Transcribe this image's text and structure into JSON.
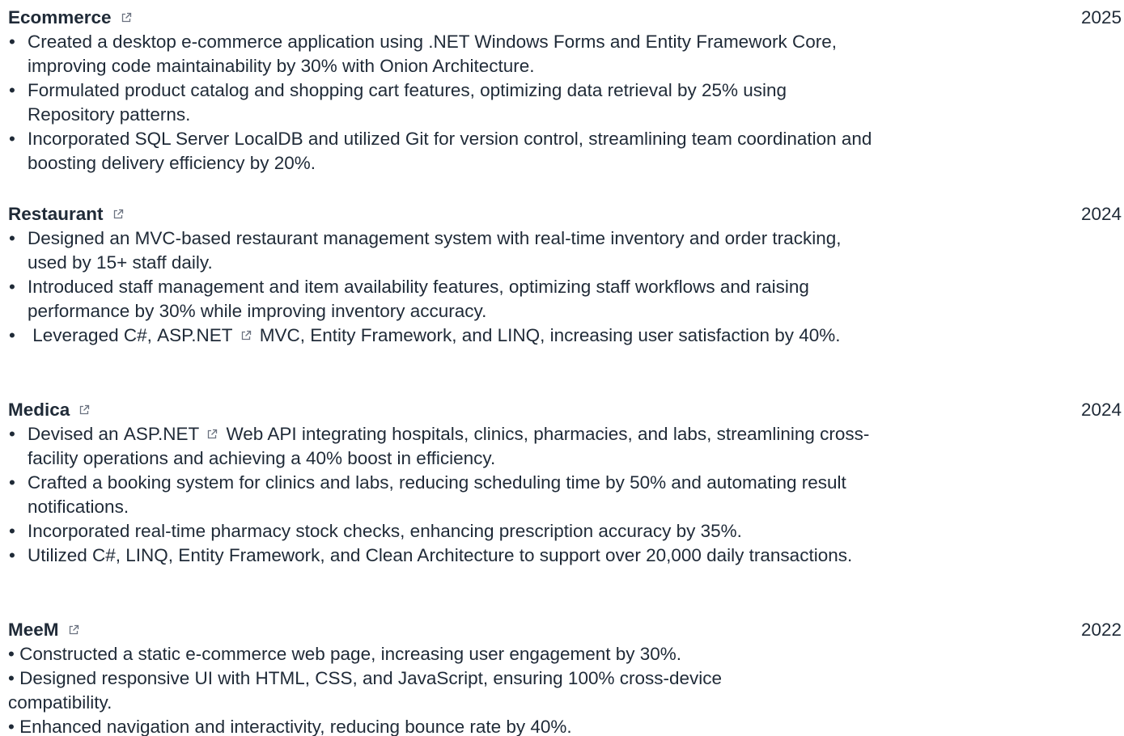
{
  "projects": [
    {
      "title": "Ecommerce",
      "year": "2025",
      "bullets": [
        "Created a desktop e-commerce application using .NET Windows Forms and Entity Framework Core, improving code maintainability by 30% with Onion Architecture.",
        "Formulated product catalog and shopping cart features, optimizing data retrieval by 25% using Repository patterns.",
        "Incorporated SQL Server LocalDB and utilized Git for version control, streamlining team coordination and boosting delivery efficiency by 20%."
      ]
    },
    {
      "title": "Restaurant",
      "year": "2024",
      "bullets": [
        "Designed an MVC-based restaurant management system with real-time inventory and order tracking, used by 15+ staff daily.",
        " Introduced staff management and item availability features, optimizing staff workflows and raising performance by 30% while improving inventory accuracy.",
        {
          "before": " Leveraged C#, ",
          "link": "ASP.NET",
          "after": " MVC, Entity Framework, and LINQ, increasing user satisfaction by 40%."
        }
      ]
    },
    {
      "title": "Medica",
      "year": "2024",
      "bullets": [
        {
          "before": "Devised an ",
          "link": "ASP.NET",
          "after": " Web API integrating hospitals, clinics, pharmacies, and labs, streamlining cross-facility operations and achieving a 40% boost in efficiency."
        },
        "Crafted a booking system for clinics and labs, reducing scheduling time by 50% and automating result notifications.",
        "Incorporated real-time pharmacy stock checks, enhancing prescription accuracy by 35%.",
        "Utilized C#, LINQ, Entity Framework, and Clean Architecture to support over 20,000 daily transactions."
      ]
    },
    {
      "title": "MeeM",
      "year": "2022",
      "lines": [
        "• Constructed a static e-commerce web page, increasing user engagement by 30%.",
        "• Designed responsive UI with HTML, CSS, and JavaScript, ensuring 100% cross-device compatibility.",
        "• Enhanced navigation and interactivity, reducing bounce rate by 40%."
      ]
    }
  ],
  "icons": {
    "external_link": "external-link-icon"
  },
  "colors": {
    "text": "#1f2a37",
    "icon": "#6b7280"
  }
}
